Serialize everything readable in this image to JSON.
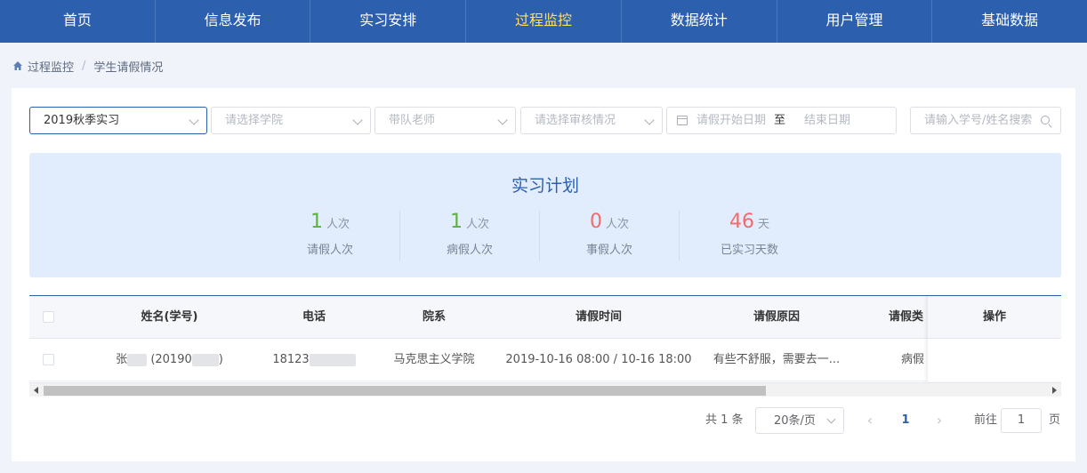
{
  "nav": {
    "items": [
      "首页",
      "信息发布",
      "实习安排",
      "过程监控",
      "数据统计",
      "用户管理",
      "基础数据"
    ],
    "active_index": 3,
    "active_color": "#ffe15a",
    "bg_color": "#2c5fae"
  },
  "breadcrumb": {
    "root": "过程监控",
    "separator": "/",
    "current": "学生请假情况"
  },
  "filters": {
    "plan": "2019秋季实习",
    "college_placeholder": "请选择学院",
    "teacher_placeholder": "带队老师",
    "review_placeholder": "请选择审核情况",
    "date_start_placeholder": "请假开始日期",
    "date_to": "至",
    "date_end_placeholder": "结束日期",
    "search_placeholder": "请输入学号/姓名搜索"
  },
  "stats": {
    "title": "实习计划",
    "items": [
      {
        "num": "1",
        "unit": "人次",
        "label": "请假人次",
        "color": "green"
      },
      {
        "num": "1",
        "unit": "人次",
        "label": "病假人次",
        "color": "green"
      },
      {
        "num": "0",
        "unit": "人次",
        "label": "事假人次",
        "color": "red"
      },
      {
        "num": "46",
        "unit": "天",
        "label": "已实习天数",
        "color": "red"
      }
    ]
  },
  "table": {
    "headers": {
      "name": "姓名(学号)",
      "phone": "电话",
      "dept": "院系",
      "time": "请假时间",
      "reason": "请假原因",
      "type": "请假类",
      "ops": "操作"
    },
    "rows": [
      {
        "name_prefix": "张",
        "name_id": "(20190",
        "name_close": ")",
        "phone": "18123",
        "dept": "马克思主义学院",
        "time": "2019-10-16 08:00 / 10-16 18:00",
        "reason": "有些不舒服，需要去一...",
        "type": "病假"
      }
    ]
  },
  "pagination": {
    "total": "共 1 条",
    "page_size": "20条/页",
    "current_page": "1",
    "goto_label": "前往",
    "goto_value": "1",
    "page_suffix": "页"
  }
}
